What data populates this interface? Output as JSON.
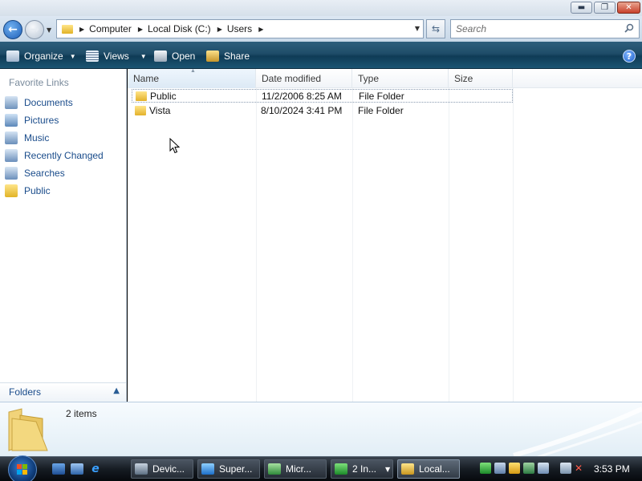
{
  "window": {
    "caption_buttons": {
      "minimize": "▬",
      "maximize": "❐",
      "close": "✕"
    }
  },
  "address": {
    "breadcrumbs": [
      "Computer",
      "Local Disk (C:)",
      "Users"
    ],
    "search_placeholder": "Search"
  },
  "commands": {
    "organize": "Organize",
    "views": "Views",
    "open": "Open",
    "share": "Share"
  },
  "nav_pane": {
    "favorites_title": "Favorite Links",
    "links": [
      {
        "label": "Documents",
        "icon": "documents-icon"
      },
      {
        "label": "Pictures",
        "icon": "pictures-icon"
      },
      {
        "label": "Music",
        "icon": "music-icon"
      },
      {
        "label": "Recently Changed",
        "icon": "recently-changed-icon"
      },
      {
        "label": "Searches",
        "icon": "searches-icon"
      },
      {
        "label": "Public",
        "icon": "folder-icon"
      }
    ],
    "folders_label": "Folders"
  },
  "file_list": {
    "columns": {
      "name": "Name",
      "date": "Date modified",
      "type": "Type",
      "size": "Size"
    },
    "rows": [
      {
        "name": "Public",
        "date": "11/2/2006 8:25 AM",
        "type": "File Folder",
        "size": "",
        "selected": true
      },
      {
        "name": "Vista",
        "date": "8/10/2024 3:41 PM",
        "type": "File Folder",
        "size": "",
        "selected": false
      }
    ]
  },
  "details": {
    "item_count": "2 items"
  },
  "taskbar": {
    "tasks": [
      {
        "label": "Devic...",
        "icon": "device-manager-icon"
      },
      {
        "label": "Super...",
        "icon": "ie-icon"
      },
      {
        "label": "Micr...",
        "icon": "media-icon"
      },
      {
        "label": "2 In...",
        "icon": "group-icon"
      },
      {
        "label": "Local...",
        "icon": "explorer-icon",
        "active": true
      }
    ],
    "clock": "3:53 PM"
  },
  "colors": {
    "command_bar": "#1f4d69",
    "link_text": "#1a4c8b",
    "folder": "#e3b12a",
    "taskbar": "#161c23"
  }
}
